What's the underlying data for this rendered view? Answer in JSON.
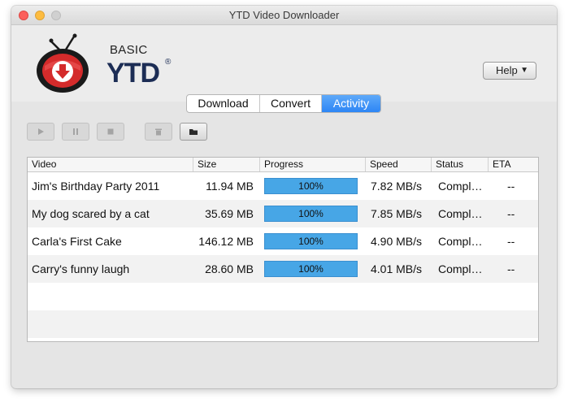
{
  "window": {
    "title": "YTD Video Downloader"
  },
  "logo": {
    "basic": "BASIC",
    "ytd": "YTD",
    "reg": "®"
  },
  "help": {
    "label": "Help",
    "arrow": "▼"
  },
  "tabs": [
    {
      "label": "Download",
      "active": false
    },
    {
      "label": "Convert",
      "active": false
    },
    {
      "label": "Activity",
      "active": true
    }
  ],
  "toolbar": [
    {
      "name": "play",
      "icon": "play-icon",
      "enabled": false
    },
    {
      "name": "pause",
      "icon": "pause-icon",
      "enabled": false
    },
    {
      "name": "stop",
      "icon": "stop-icon",
      "enabled": false
    },
    {
      "name": "delete",
      "icon": "trash-icon",
      "enabled": false
    },
    {
      "name": "open-folder",
      "icon": "folder-icon",
      "enabled": true
    }
  ],
  "table": {
    "columns": [
      "Video",
      "Size",
      "Progress",
      "Speed",
      "Status",
      "ETA"
    ],
    "rows": [
      {
        "video": "Jim's Birthday Party 2011",
        "size": "11.94 MB",
        "progress": "100%",
        "progress_fraction": 1.0,
        "speed": "7.82 MB/s",
        "status": "Compl…",
        "eta": "--"
      },
      {
        "video": "My dog scared by a cat",
        "size": "35.69 MB",
        "progress": "100%",
        "progress_fraction": 1.0,
        "speed": "7.85 MB/s",
        "status": "Compl…",
        "eta": "--"
      },
      {
        "video": "Carla's First Cake",
        "size": "146.12 MB",
        "progress": "100%",
        "progress_fraction": 1.0,
        "speed": "4.90 MB/s",
        "status": "Compl…",
        "eta": "--"
      },
      {
        "video": "Carry's funny laugh",
        "size": "28.60 MB",
        "progress": "100%",
        "progress_fraction": 1.0,
        "speed": "4.01 MB/s",
        "status": "Compl…",
        "eta": "--"
      }
    ]
  },
  "colors": {
    "accent": "#2d86f5",
    "progress": "#47a6e6",
    "logo_red": "#d42b2b",
    "logo_navy": "#1c2d55"
  }
}
